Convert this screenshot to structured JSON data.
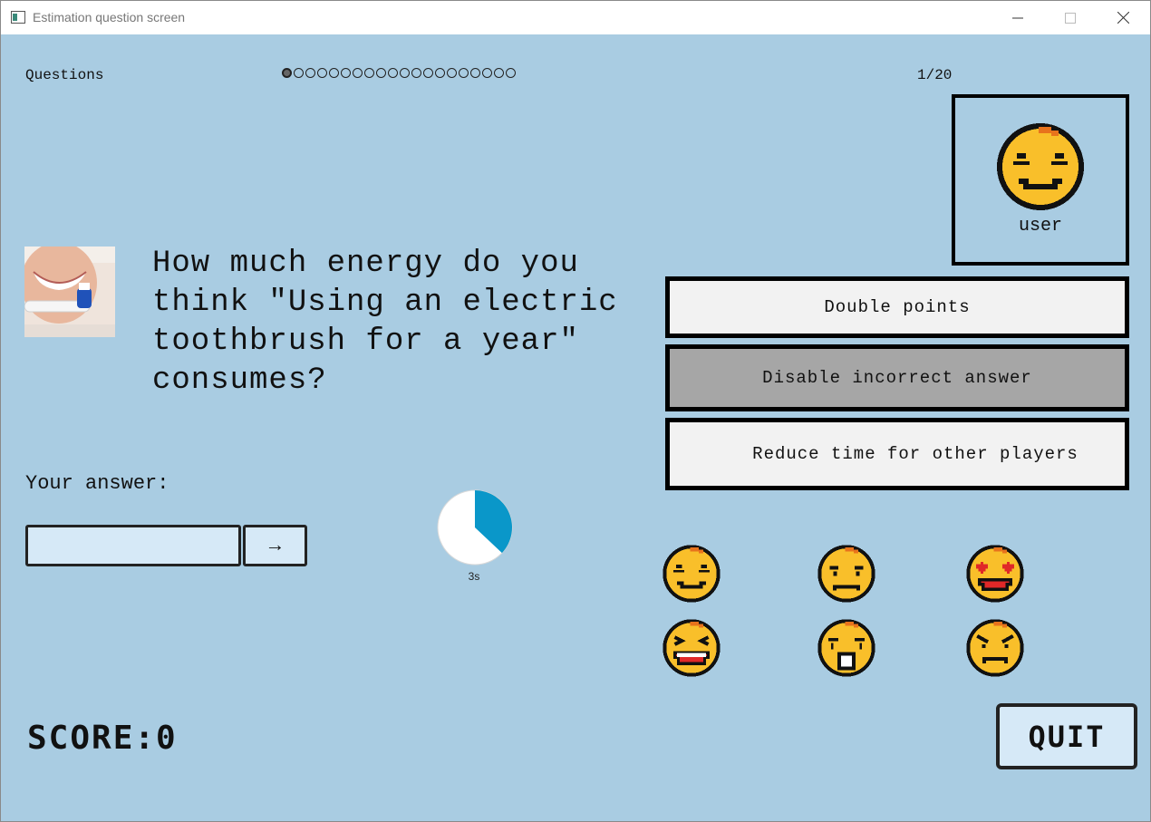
{
  "window": {
    "title": "Estimation question screen"
  },
  "progress": {
    "label": "Questions",
    "count_text": "1/20",
    "total": 20,
    "current": 1
  },
  "user": {
    "name": "user"
  },
  "question": {
    "text": "How much energy do you think \"Using an electric toothbrush for a year\" consumes?"
  },
  "powerups": {
    "double_points": "Double points",
    "disable_incorrect": "Disable incorrect answer",
    "reduce_time": "Reduce time for other players"
  },
  "answer": {
    "label": "Your answer:",
    "value": "",
    "submit_label": "→"
  },
  "timer": {
    "text": "3s",
    "fraction_elapsed": 0.37,
    "color": "#0a97c9"
  },
  "emojis": [
    "smile-icon",
    "sad-icon",
    "heart-eyes-icon",
    "laughing-icon",
    "surprised-icon",
    "angry-icon"
  ],
  "score": {
    "text": "SCORE:0"
  },
  "quit": {
    "label": "QUIT"
  },
  "colors": {
    "background": "#a9cce2",
    "button": "#d6e9f7",
    "emoji_yellow": "#f9bf2a"
  }
}
